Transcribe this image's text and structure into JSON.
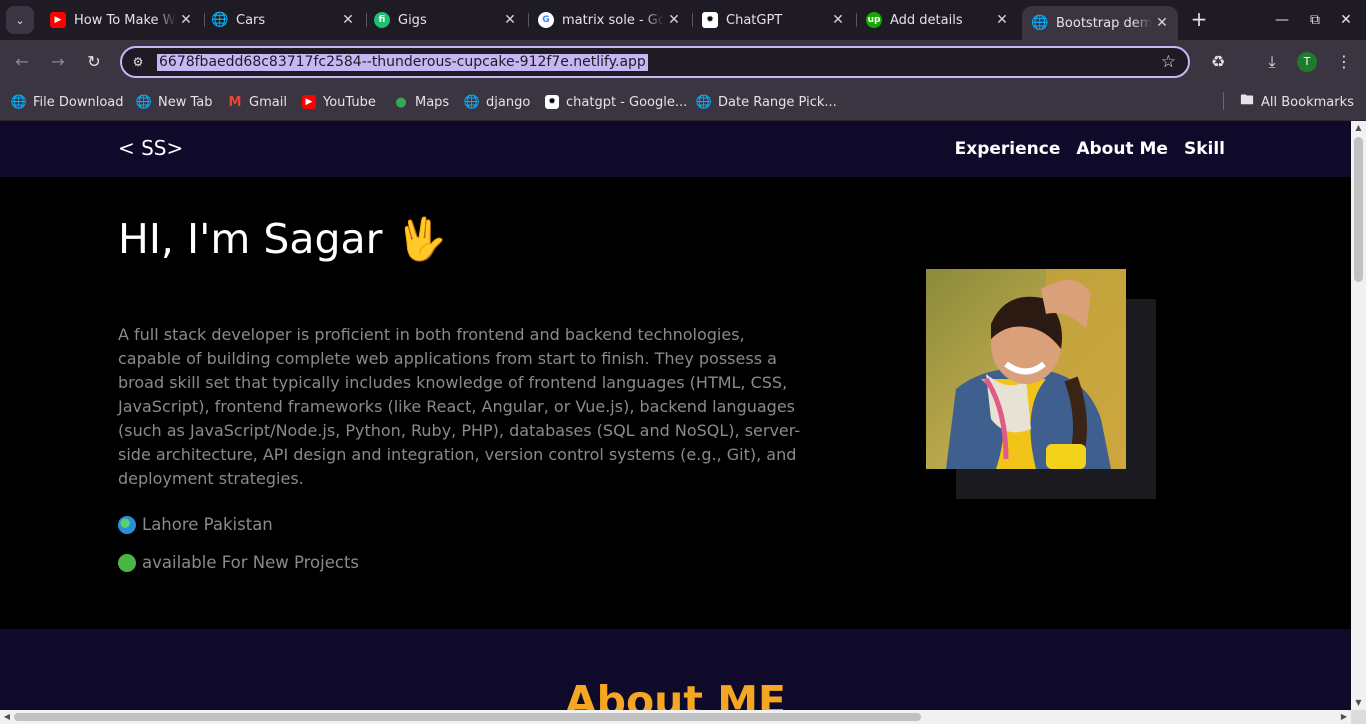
{
  "browser": {
    "tabs": [
      {
        "title": "How To Make W",
        "icon": "youtube-icon",
        "favicon_color": "#ff0000"
      },
      {
        "title": "Cars",
        "icon": "globe-icon",
        "favicon_color": "#cfcfcf"
      },
      {
        "title": "Gigs",
        "icon": "fiverr-icon",
        "favicon_color": "#1dbf73"
      },
      {
        "title": "matrix sole - Go",
        "icon": "google-icon",
        "favicon_color": "#ffffff"
      },
      {
        "title": "ChatGPT",
        "icon": "chatgpt-icon",
        "favicon_color": "#ffffff"
      },
      {
        "title": "Add details",
        "icon": "upwork-icon",
        "favicon_color": "#14a800"
      },
      {
        "title": "Bootstrap dem",
        "icon": "globe-icon",
        "favicon_color": "#cfcfcf",
        "active": true
      }
    ],
    "url": "6678fbaedd68c83717fc2584--thunderous-cupcake-912f7e.netlify.app",
    "profile_initial": "T",
    "bookmarks": [
      {
        "label": "File Download",
        "icon": "globe-icon"
      },
      {
        "label": "New Tab",
        "icon": "globe-icon"
      },
      {
        "label": "Gmail",
        "icon": "gmail-icon"
      },
      {
        "label": "YouTube",
        "icon": "youtube-icon"
      },
      {
        "label": "Maps",
        "icon": "maps-icon"
      },
      {
        "label": "django",
        "icon": "globe-icon"
      },
      {
        "label": "chatgpt - Google...",
        "icon": "chatgpt-icon"
      },
      {
        "label": "Date Range Pick...",
        "icon": "globe-icon"
      }
    ],
    "all_bookmarks": "All Bookmarks"
  },
  "site": {
    "brand": "< SS>",
    "nav": [
      "Experience",
      "About Me",
      "Skill"
    ],
    "hero": {
      "title": "HI, I'm Sagar 🖖",
      "description": "A full stack developer is proficient in both frontend and backend technologies, capable of building complete web applications from start to finish. They possess a broad skill set that typically includes knowledge of frontend languages (HTML, CSS, JavaScript), frontend frameworks (like React, Angular, or Vue.js), backend languages (such as JavaScript/Node.js, Python, Ruby, PHP), databases (SQL and NoSQL), server-side architecture, API design and integration, version control systems (e.g., Git), and deployment strategies.",
      "location": "Lahore Pakistan",
      "availability": "available For New Projects"
    },
    "about_title": "About ME",
    "colors": {
      "nav_bg": "#0f0a2a",
      "hero_bg": "#000000",
      "accent": "#f5a623",
      "text_muted": "#8a8a8a"
    }
  }
}
